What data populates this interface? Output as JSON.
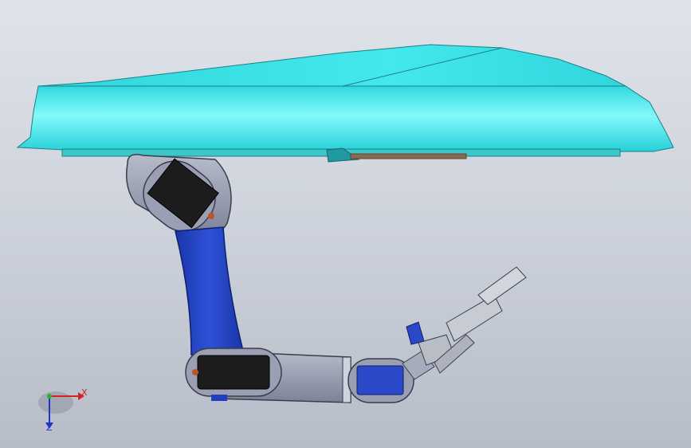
{
  "viewport": {
    "background_top": "#dfe3ea",
    "background_bottom": "#b7bdc8"
  },
  "model": {
    "parts": [
      "hull-canopy",
      "servo-bracket-shoulder",
      "upper-arm-link",
      "servo-bracket-elbow",
      "forearm-link",
      "servo-bracket-wrist",
      "gripper"
    ],
    "colors": {
      "hull": "#33e6ea",
      "hull_highlight": "#7ff6f8",
      "link_blue": "#1f3fbf",
      "bracket_gray": "#8d92a8",
      "servo_black": "#1b1b1b",
      "servo_blue": "#2a48c8",
      "gripper_gray": "#b9bdc6"
    }
  },
  "triad": {
    "x_label": "X",
    "z_label": "Z",
    "x_color": "#d8202a",
    "y_color": "#2bb02b",
    "z_color": "#2233cc"
  }
}
